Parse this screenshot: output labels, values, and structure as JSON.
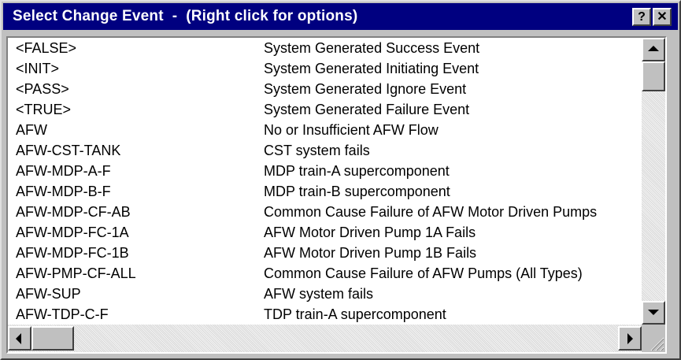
{
  "window": {
    "title": "Select Change Event  -  (Right click for options)",
    "help_button": "?",
    "close_button": "✕"
  },
  "events": [
    {
      "name": "<FALSE>",
      "description": "System Generated Success Event"
    },
    {
      "name": "<INIT>",
      "description": "System Generated Initiating Event"
    },
    {
      "name": "<PASS>",
      "description": "System Generated Ignore Event"
    },
    {
      "name": "<TRUE>",
      "description": "System Generated Failure Event"
    },
    {
      "name": "AFW",
      "description": "No or Insufficient AFW Flow"
    },
    {
      "name": "AFW-CST-TANK",
      "description": "CST system fails"
    },
    {
      "name": "AFW-MDP-A-F",
      "description": "MDP train-A supercomponent"
    },
    {
      "name": "AFW-MDP-B-F",
      "description": "MDP train-B supercomponent"
    },
    {
      "name": "AFW-MDP-CF-AB",
      "description": "Common Cause Failure of AFW Motor Driven Pumps"
    },
    {
      "name": "AFW-MDP-FC-1A",
      "description": "AFW Motor Driven Pump 1A Fails"
    },
    {
      "name": "AFW-MDP-FC-1B",
      "description": "AFW Motor Driven  Pump 1B Fails"
    },
    {
      "name": "AFW-PMP-CF-ALL",
      "description": "Common Cause Failure of AFW Pumps (All Types)"
    },
    {
      "name": "AFW-SUP",
      "description": "AFW system fails"
    },
    {
      "name": "AFW-TDP-C-F",
      "description": "TDP train-A supercomponent"
    }
  ]
}
